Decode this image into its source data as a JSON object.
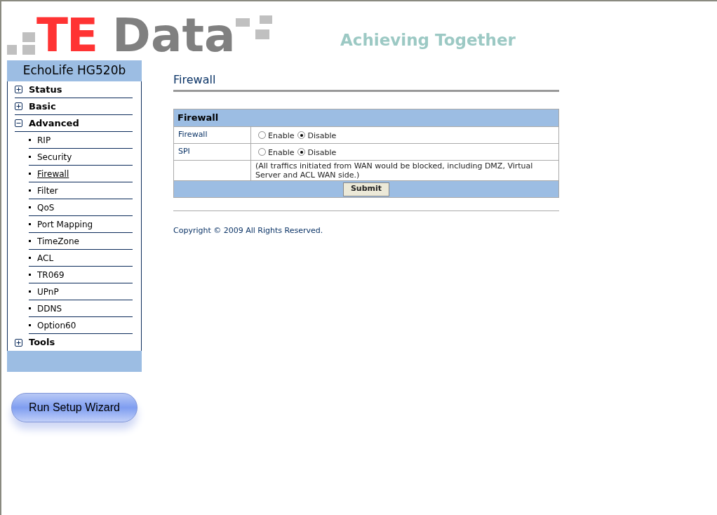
{
  "logo": {
    "part_1": "TE",
    "part_2": "Data"
  },
  "slogan": "Achieving Together",
  "sidebar": {
    "title": "EchoLife HG520b",
    "items": [
      {
        "label": "Status",
        "expanded": false
      },
      {
        "label": "Basic",
        "expanded": false
      },
      {
        "label": "Advanced",
        "expanded": true,
        "children": [
          {
            "label": "RIP",
            "selected": false
          },
          {
            "label": "Security",
            "selected": false
          },
          {
            "label": "Firewall",
            "selected": true
          },
          {
            "label": "Filter",
            "selected": false
          },
          {
            "label": "QoS",
            "selected": false
          },
          {
            "label": "Port Mapping",
            "selected": false
          },
          {
            "label": "TimeZone",
            "selected": false
          },
          {
            "label": "ACL",
            "selected": false
          },
          {
            "label": "TR069",
            "selected": false
          },
          {
            "label": "UPnP",
            "selected": false
          },
          {
            "label": "DDNS",
            "selected": false
          },
          {
            "label": "Option60",
            "selected": false
          }
        ]
      },
      {
        "label": "Tools",
        "expanded": false
      }
    ]
  },
  "wizard_button": "Run Setup Wizard",
  "page_title": "Firewall",
  "form": {
    "header": "Firewall",
    "rows": [
      {
        "label": "Firewall",
        "options": [
          {
            "label": "Enable",
            "checked": false
          },
          {
            "label": "Disable",
            "checked": true
          }
        ]
      },
      {
        "label": "SPI",
        "options": [
          {
            "label": "Enable",
            "checked": false
          },
          {
            "label": "Disable",
            "checked": true
          }
        ]
      }
    ],
    "note": "(All traffics initiated from WAN would be blocked, including DMZ, Virtual Server and ACL WAN side.)",
    "submit": "Submit"
  },
  "footer": "Copyright © 2009 All Rights Reserved."
}
